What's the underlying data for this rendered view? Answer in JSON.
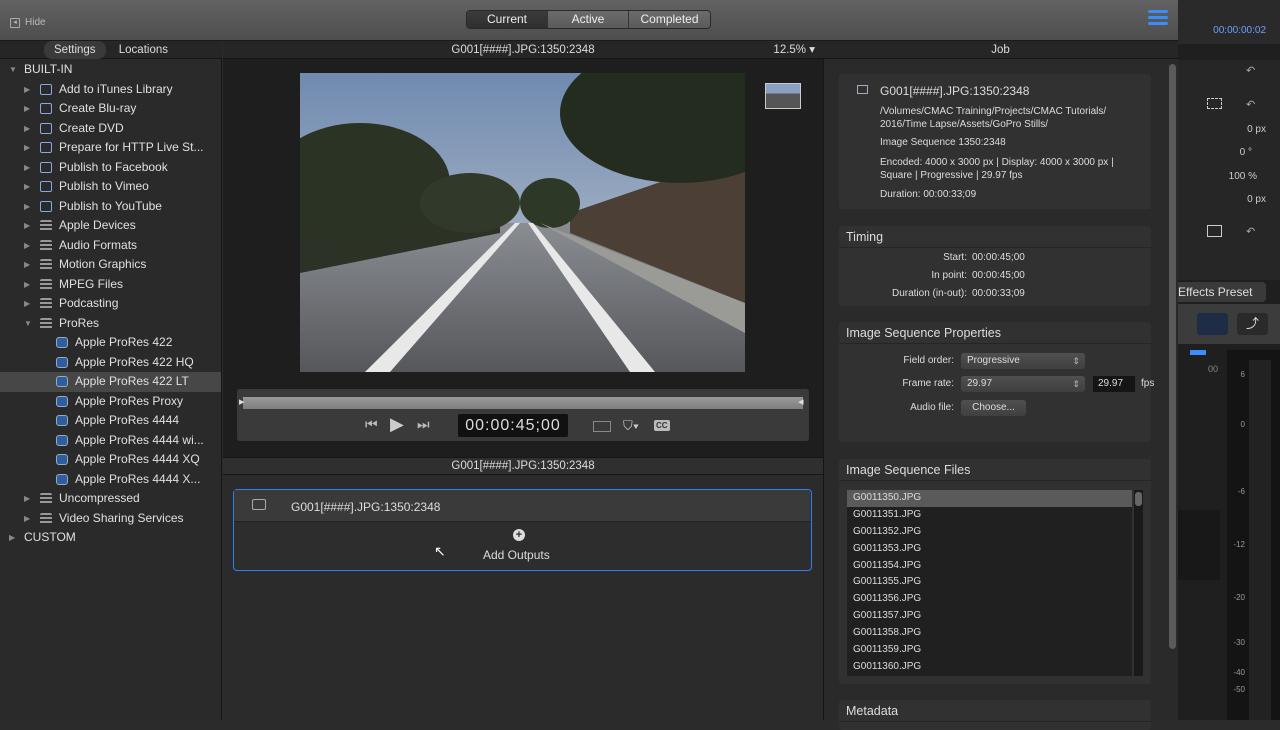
{
  "toolbar": {
    "hide_label": "Hide",
    "tabs": [
      "Current",
      "Active",
      "Completed"
    ],
    "active_tab": "Current"
  },
  "sidebar": {
    "tabs": [
      "Settings",
      "Locations"
    ],
    "groups": [
      {
        "label": "BUILT-IN"
      },
      {
        "label": "CUSTOM"
      }
    ],
    "items": [
      {
        "label": "Add to iTunes Library",
        "icon": "share-icon"
      },
      {
        "label": "Create Blu-ray",
        "icon": "share-icon"
      },
      {
        "label": "Create DVD",
        "icon": "share-icon"
      },
      {
        "label": "Prepare for HTTP Live St...",
        "icon": "share-icon"
      },
      {
        "label": "Publish to Facebook",
        "icon": "share-icon"
      },
      {
        "label": "Publish to Vimeo",
        "icon": "share-icon"
      },
      {
        "label": "Publish to YouTube",
        "icon": "share-icon"
      },
      {
        "label": "Apple Devices",
        "icon": "settings-icon"
      },
      {
        "label": "Audio Formats",
        "icon": "settings-icon"
      },
      {
        "label": "Motion Graphics",
        "icon": "settings-icon"
      },
      {
        "label": "MPEG Files",
        "icon": "settings-icon"
      },
      {
        "label": "Podcasting",
        "icon": "settings-icon"
      },
      {
        "label": "ProRes",
        "icon": "settings-icon",
        "expanded": true
      },
      {
        "label": "Apple ProRes 422",
        "child": true
      },
      {
        "label": "Apple ProRes 422 HQ",
        "child": true
      },
      {
        "label": "Apple ProRes 422 LT",
        "child": true,
        "selected": true
      },
      {
        "label": "Apple ProRes Proxy",
        "child": true
      },
      {
        "label": "Apple ProRes 4444",
        "child": true
      },
      {
        "label": "Apple ProRes 4444 wi...",
        "child": true
      },
      {
        "label": "Apple ProRes 4444 XQ",
        "child": true
      },
      {
        "label": "Apple ProRes 4444 X...",
        "child": true
      },
      {
        "label": "Uncompressed",
        "icon": "settings-icon"
      },
      {
        "label": "Video Sharing Services",
        "icon": "settings-icon"
      }
    ]
  },
  "viewer": {
    "title": "G001[####].JPG:1350:2348",
    "zoom": "12.5%",
    "timecode": "00:00:45;00",
    "cc_label": "CC",
    "source_title": "G001[####].JPG:1350:2348"
  },
  "batch": {
    "job_title": "G001[####].JPG:1350:2348",
    "add_outputs": "Add Outputs"
  },
  "inspector": {
    "title": "Job",
    "summary": {
      "name": "G001[####].JPG:1350:2348",
      "path": "/Volumes/CMAC Training/Projects/CMAC Tutorials/ 2016/Time Lapse/Assets/GoPro Stills/",
      "type": "Image Sequence 1350:2348",
      "encoded": "Encoded: 4000 x 3000 px | Display: 4000 x 3000 px | Square | Progressive | 29.97 fps",
      "duration": "Duration: 00:00:33;09"
    },
    "timing": {
      "title": "Timing",
      "rows": [
        {
          "label": "Start:",
          "value": "00:00:45;00"
        },
        {
          "label": "In point:",
          "value": "00:00:45;00"
        },
        {
          "label": "Duration (in-out):",
          "value": "00:00:33;09"
        }
      ]
    },
    "props": {
      "title": "Image Sequence Properties",
      "field_order_label": "Field order:",
      "field_order": "Progressive",
      "frame_rate_label": "Frame rate:",
      "frame_rate": "29.97",
      "frame_rate_value": "29.97",
      "fps": "fps",
      "audio_label": "Audio file:",
      "choose": "Choose..."
    },
    "files": {
      "title": "Image Sequence Files",
      "items": [
        "G0011350.JPG",
        "G0011351.JPG",
        "G0011352.JPG",
        "G0011353.JPG",
        "G0011354.JPG",
        "G0011355.JPG",
        "G0011356.JPG",
        "G0011357.JPG",
        "G0011358.JPG",
        "G0011359.JPG",
        "G0011360.JPG"
      ]
    },
    "metadata": {
      "title": "Metadata"
    }
  },
  "fcp": {
    "timecode": "00:00:00:02",
    "values": [
      "0 px",
      "0 °",
      "100 %",
      "0 px"
    ],
    "effects_preset": "Effects Preset",
    "ruler": "00",
    "meter": [
      "6",
      "0",
      "-6",
      "-12",
      "-20",
      "-30",
      "-40",
      "-50"
    ]
  },
  "colors": {
    "accent": "#2f7ff0"
  }
}
